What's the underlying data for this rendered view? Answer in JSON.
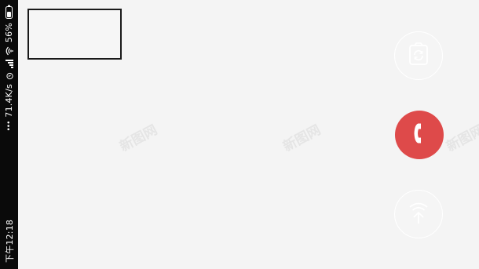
{
  "status_bar": {
    "time": "下午12:18",
    "net_speed": "71.4K/s",
    "battery_percent": "56%",
    "overflow_dots": "•••"
  },
  "watermark": {
    "text": "新图网"
  },
  "controls": {
    "switch_camera_icon": "camera-switch-icon",
    "hangup_icon": "phone-icon",
    "swipe_icon": "swipe-up-icon"
  },
  "colors": {
    "hangup": "#de4a4a",
    "background": "#f4f4f4",
    "status_bar": "#0a0a0a"
  }
}
